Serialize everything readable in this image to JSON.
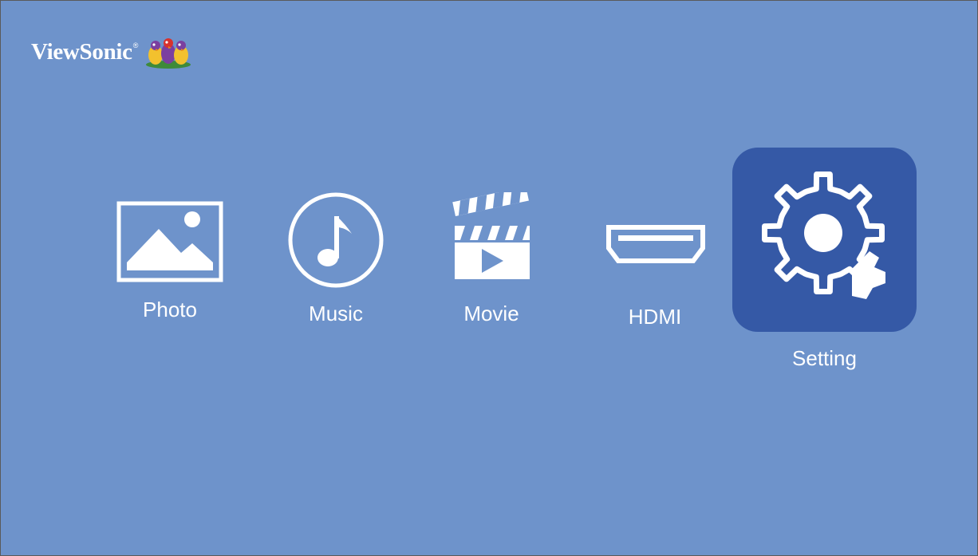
{
  "colors": {
    "background": "#6e93cb",
    "selected_tile": "#3559a6",
    "foreground": "#ffffff"
  },
  "header": {
    "brand": "ViewSonic",
    "brand_mark": "®",
    "mascot_icon": "three-birds-logo"
  },
  "menu": {
    "selected": "Setting",
    "items": [
      {
        "label": "Photo",
        "icon": "photo-icon"
      },
      {
        "label": "Music",
        "icon": "music-note-icon"
      },
      {
        "label": "Movie",
        "icon": "clapperboard-icon"
      },
      {
        "label": "HDMI",
        "icon": "hdmi-port-icon"
      },
      {
        "label": "Setting",
        "icon": "gear-wrench-icon"
      }
    ]
  }
}
